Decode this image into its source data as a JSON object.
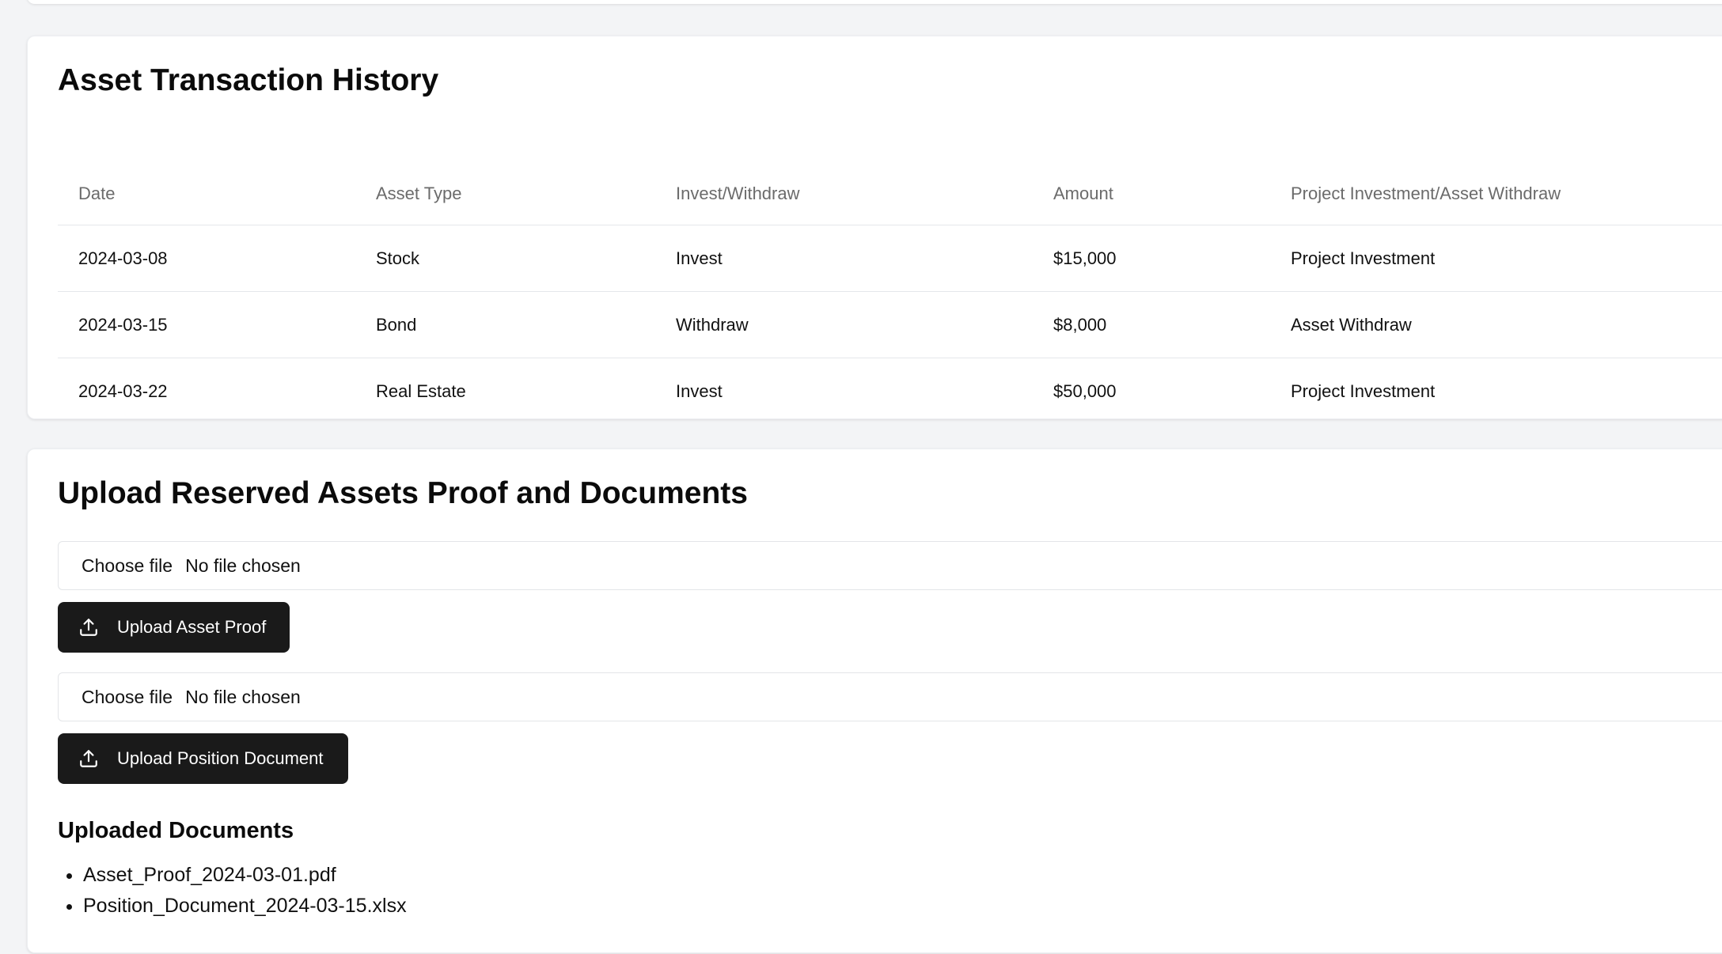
{
  "history": {
    "title": "Asset Transaction History",
    "columns": [
      "Date",
      "Asset Type",
      "Invest/Withdraw",
      "Amount",
      "Project Investment/Asset Withdraw"
    ],
    "rows": [
      [
        "2024-03-08",
        "Stock",
        "Invest",
        "$15,000",
        "Project Investment"
      ],
      [
        "2024-03-15",
        "Bond",
        "Withdraw",
        "$8,000",
        "Asset Withdraw"
      ],
      [
        "2024-03-22",
        "Real Estate",
        "Invest",
        "$50,000",
        "Project Investment"
      ]
    ]
  },
  "upload": {
    "title": "Upload Reserved Assets Proof and Documents",
    "file_inputs": [
      {
        "choose_label": "Choose file",
        "status": "No file chosen"
      },
      {
        "choose_label": "Choose file",
        "status": "No file chosen"
      }
    ],
    "buttons": {
      "asset_proof": "Upload Asset Proof",
      "position_document": "Upload Position Document"
    },
    "uploaded_title": "Uploaded Documents",
    "uploaded_files": [
      "Asset_Proof_2024-03-01.pdf",
      "Position_Document_2024-03-15.xlsx"
    ]
  },
  "icons": {
    "upload": "upload-icon"
  },
  "colors": {
    "page_bg": "#f3f4f6",
    "card_bg": "#ffffff",
    "button_bg": "#1a1a1a",
    "header_text": "#6b6b6b"
  }
}
